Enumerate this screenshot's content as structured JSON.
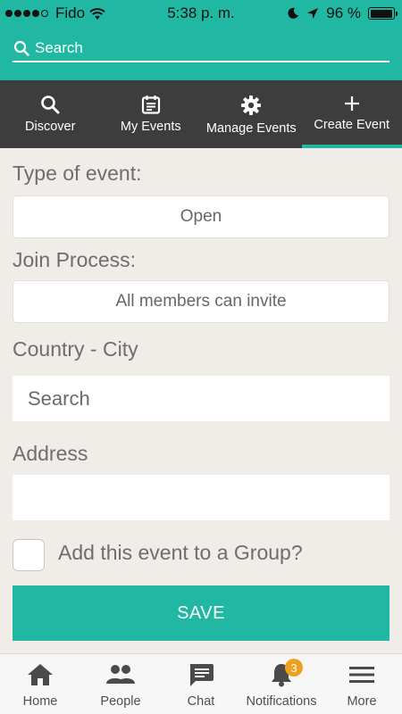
{
  "status": {
    "carrier": "Fido",
    "time": "5:38 p. m.",
    "battery": "96 %",
    "battery_level": 0.96
  },
  "search": {
    "placeholder": "Search"
  },
  "tabs": [
    {
      "label": "Discover",
      "icon": "search-icon"
    },
    {
      "label": "My Events",
      "icon": "calendar-icon"
    },
    {
      "label": "Manage Events",
      "icon": "gear-icon"
    },
    {
      "label": "Create Event",
      "icon": "plus-icon",
      "active": true
    }
  ],
  "form": {
    "type_label": "Type of event:",
    "type_value": "Open",
    "join_label": "Join Process:",
    "join_value": "All members can invite",
    "country_label": "Country - City",
    "country_placeholder": "Search",
    "address_label": "Address",
    "address_value": "",
    "group_label": "Add this event to a Group?",
    "save_label": "SAVE"
  },
  "bottom_nav": [
    {
      "label": "Home",
      "icon": "home-icon"
    },
    {
      "label": "People",
      "icon": "people-icon"
    },
    {
      "label": "Chat",
      "icon": "chat-icon"
    },
    {
      "label": "Notifications",
      "icon": "bell-icon",
      "badge": "3"
    },
    {
      "label": "More",
      "icon": "menu-icon"
    }
  ],
  "colors": {
    "accent": "#20b8a2",
    "tab_bar": "#3d3d3d",
    "badge": "#f0a020",
    "background": "#f0ede9"
  }
}
